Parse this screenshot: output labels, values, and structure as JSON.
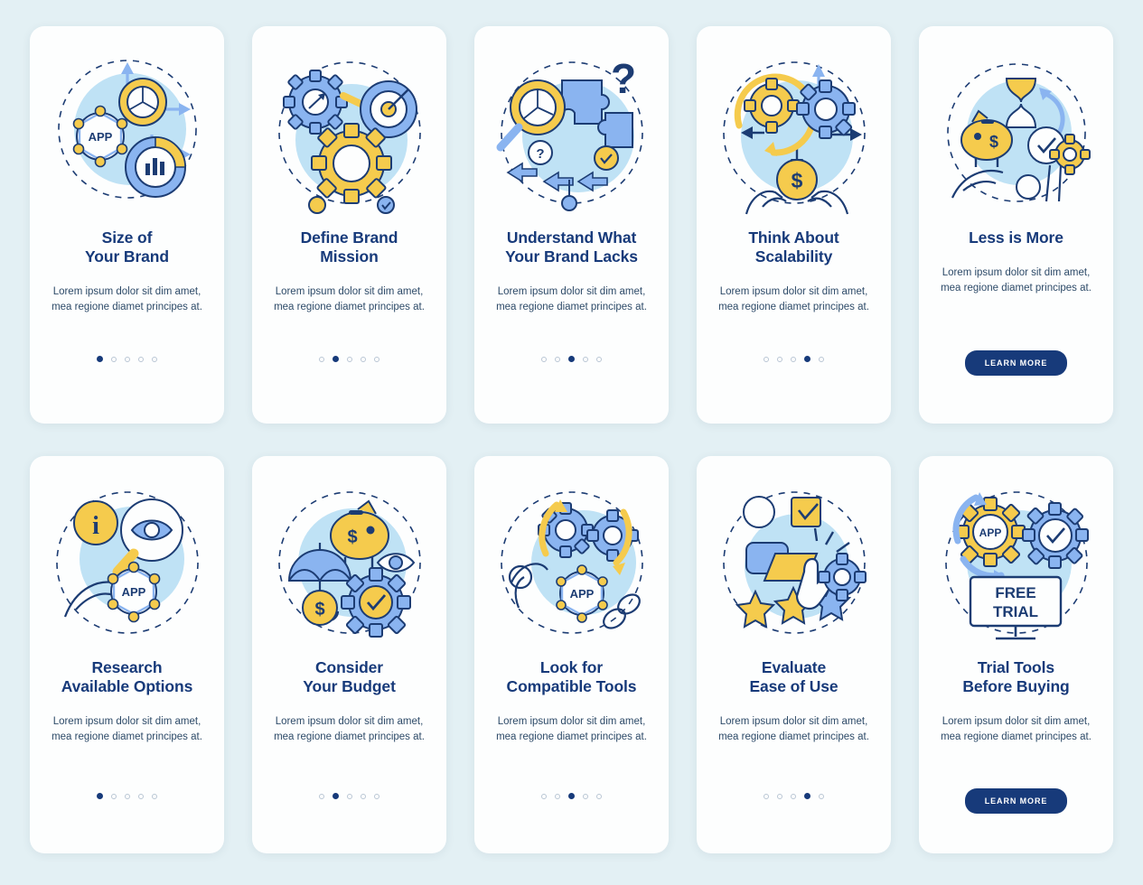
{
  "page": {
    "background_color": "#e3f0f4",
    "card_background": "#fdfefe",
    "title_color": "#173a7a",
    "body_color": "#2d4a68",
    "accent_blue": "#8ab4f0",
    "accent_yellow": "#f5cb4d",
    "accent_lightblue": "#bfe2f5",
    "cta_background": "#173a7a",
    "cta_text_color": "#ffffff"
  },
  "body_text": "Lorem ipsum dolor sit dim amet, mea regione diamet principes at.",
  "cta_label": "LEARN MORE",
  "rows": [
    {
      "cards": [
        {
          "title_line1": "Size of",
          "title_line2": "Your Brand",
          "body": "Lorem ipsum dolor sit dim amet, mea regione diamet principes at.",
          "icon": "app-network-growth-icon",
          "dots": 5,
          "active_dot": 1,
          "cta": null
        },
        {
          "title_line1": "Define Brand",
          "title_line2": "Mission",
          "body": "Lorem ipsum dolor sit dim amet, mea regione diamet principes at.",
          "icon": "gears-target-icon",
          "dots": 5,
          "active_dot": 2,
          "cta": null
        },
        {
          "title_line1": "Understand What",
          "title_line2": "Your Brand Lacks",
          "body": "Lorem ipsum dolor sit dim amet, mea regione diamet principes at.",
          "icon": "magnifier-puzzle-question-icon",
          "dots": 5,
          "active_dot": 3,
          "cta": null
        },
        {
          "title_line1": "Think About",
          "title_line2": "Scalability",
          "body": "Lorem ipsum dolor sit dim amet, mea regione diamet principes at.",
          "icon": "gears-hands-dollar-icon",
          "dots": 5,
          "active_dot": 4,
          "cta": null
        },
        {
          "title_line1": "Less is More",
          "title_line2": "",
          "body": "Lorem ipsum dolor sit dim amet, mea regione diamet principes at.",
          "icon": "piggybank-hourglass-check-icon",
          "dots": 5,
          "active_dot": 5,
          "cta": "LEARN MORE"
        }
      ]
    },
    {
      "cards": [
        {
          "title_line1": "Research",
          "title_line2": "Available Options",
          "body": "Lorem ipsum dolor sit dim amet, mea regione diamet principes at.",
          "icon": "info-magnifier-app-icon",
          "dots": 5,
          "active_dot": 1,
          "cta": null
        },
        {
          "title_line1": "Consider",
          "title_line2": "Your Budget",
          "body": "Lorem ipsum dolor sit dim amet, mea regione diamet principes at.",
          "icon": "piggybank-umbrella-gear-icon",
          "dots": 5,
          "active_dot": 2,
          "cta": null
        },
        {
          "title_line1": "Look for",
          "title_line2": "Compatible Tools",
          "body": "Lorem ipsum dolor sit dim amet, mea regione diamet principes at.",
          "icon": "gears-chain-app-icon",
          "dots": 5,
          "active_dot": 3,
          "cta": null
        },
        {
          "title_line1": "Evaluate",
          "title_line2": "Ease of Use",
          "body": "Lorem ipsum dolor sit dim amet, mea regione diamet principes at.",
          "icon": "stars-cursor-gear-icon",
          "dots": 5,
          "active_dot": 4,
          "cta": null
        },
        {
          "title_line1": "Trial Tools",
          "title_line2": "Before Buying",
          "body": "Lorem ipsum dolor sit dim amet, mea regione diamet principes at.",
          "icon": "free-trial-gears-icon",
          "dots": 5,
          "active_dot": 5,
          "cta": "LEARN MORE"
        }
      ],
      "free_trial_label_line1": "FREE",
      "free_trial_label_line2": "TRIAL"
    }
  ],
  "illustration_labels": {
    "app": "APP",
    "dollar": "$",
    "question": "?",
    "info": "i",
    "free_trial_1": "FREE",
    "free_trial_2": "TRIAL"
  }
}
